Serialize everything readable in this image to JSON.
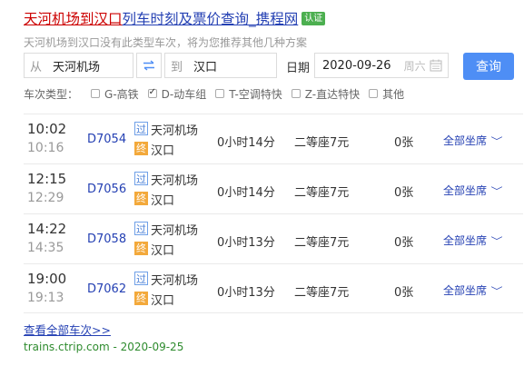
{
  "header": {
    "title_part1": "天河机场到汉口",
    "title_part2": "列车时刻及票价查询_携程网",
    "badge": "认证",
    "note": "天河机场到汉口没有此类型车次，将为您推荐其他几种方案"
  },
  "search": {
    "from_prefix": "从",
    "from_value": "天河机场",
    "to_prefix": "到",
    "to_value": "汉口",
    "date_label": "日期",
    "date_value": "2020-09-26",
    "weekday": "周六",
    "query_button": "查询"
  },
  "filters": {
    "label": "车次类型：",
    "options": [
      {
        "label": "G-高铁",
        "checked": false
      },
      {
        "label": "D-动车组",
        "checked": true
      },
      {
        "label": "T-空调特快",
        "checked": false
      },
      {
        "label": "Z-直达特快",
        "checked": false
      },
      {
        "label": "其他",
        "checked": false
      }
    ]
  },
  "trains": [
    {
      "depart": "10:02",
      "arrive": "10:16",
      "number": "D7054",
      "pass_tag": "过",
      "end_tag": "终",
      "from": "天河机场",
      "to": "汉口",
      "duration": "0小时14分",
      "seat": "二等座7元",
      "tickets": "0张",
      "all_seats": "全部坐席"
    },
    {
      "depart": "12:15",
      "arrive": "12:29",
      "number": "D7056",
      "pass_tag": "过",
      "end_tag": "终",
      "from": "天河机场",
      "to": "汉口",
      "duration": "0小时14分",
      "seat": "二等座7元",
      "tickets": "0张",
      "all_seats": "全部坐席"
    },
    {
      "depart": "14:22",
      "arrive": "14:35",
      "number": "D7058",
      "pass_tag": "过",
      "end_tag": "终",
      "from": "天河机场",
      "to": "汉口",
      "duration": "0小时13分",
      "seat": "二等座7元",
      "tickets": "0张",
      "all_seats": "全部坐席"
    },
    {
      "depart": "19:00",
      "arrive": "19:13",
      "number": "D7062",
      "pass_tag": "过",
      "end_tag": "终",
      "from": "天河机场",
      "to": "汉口",
      "duration": "0小时13分",
      "seat": "二等座7元",
      "tickets": "0张",
      "all_seats": "全部坐席"
    }
  ],
  "footer": {
    "more_link": "查看全部车次>>",
    "source": "trains.ctrip.com - 2020-09-25"
  }
}
